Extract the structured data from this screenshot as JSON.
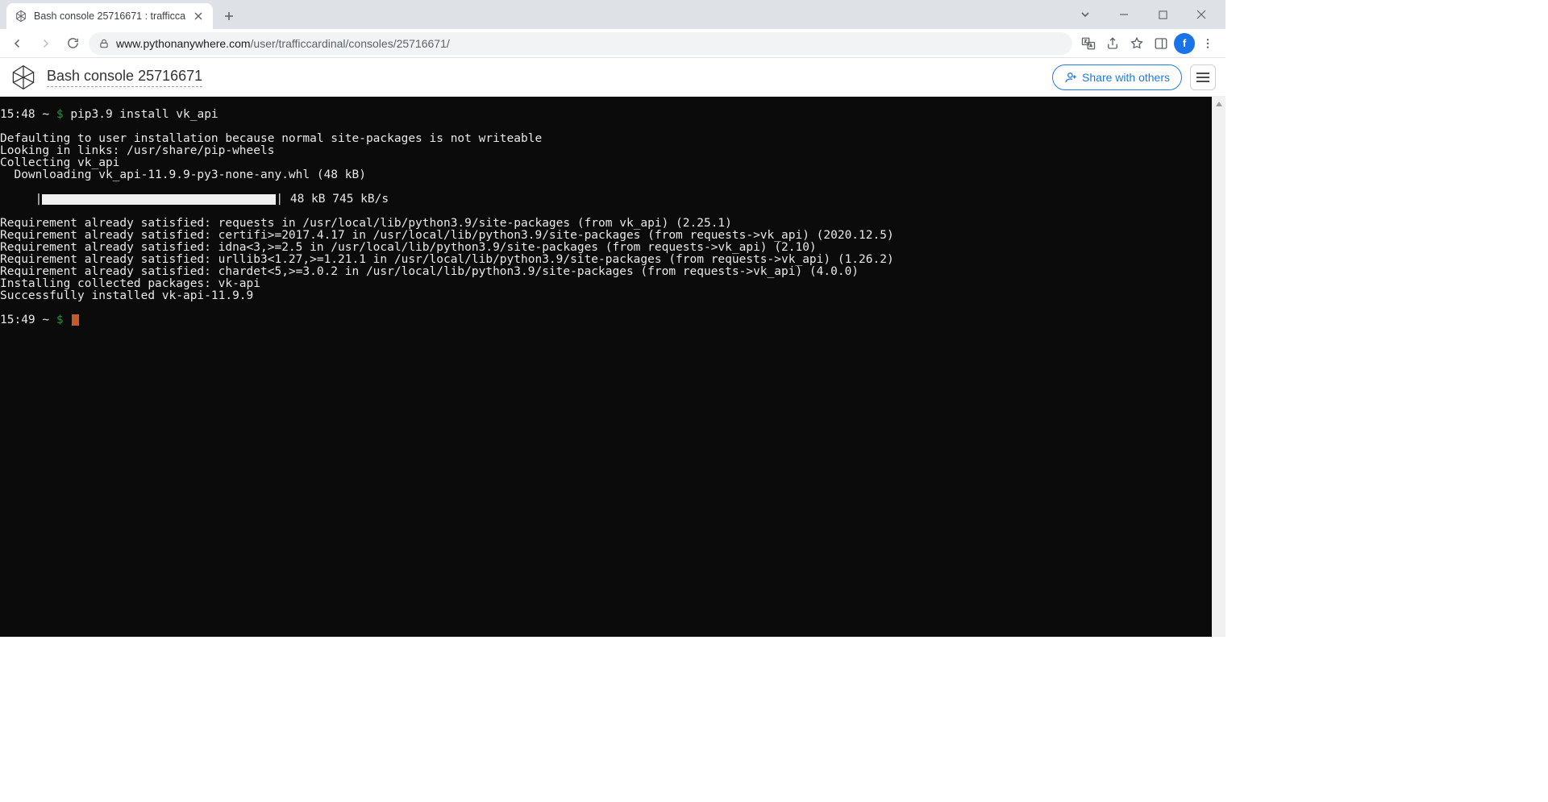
{
  "browser": {
    "tab_title": "Bash console 25716671 : trafficca",
    "url_host": "www.pythonanywhere.com",
    "url_path": "/user/trafficcardinal/consoles/25716671/",
    "avatar_letter": "f"
  },
  "page": {
    "title": "Bash console 25716671",
    "share_label": "Share with others"
  },
  "terminal": {
    "prompt1_time": "15:48",
    "prompt1_cwd": "~",
    "prompt1_symbol": "$",
    "prompt1_cmd": "pip3.9 install vk_api",
    "lines_before_progress": [
      "Defaulting to user installation because normal site-packages is not writeable",
      "Looking in links: /usr/share/pip-wheels",
      "Collecting vk_api",
      "  Downloading vk_api-11.9.9-py3-none-any.whl (48 kB)"
    ],
    "progress_prefix": "     |",
    "progress_suffix": "| 48 kB 745 kB/s",
    "lines_after_progress": [
      "Requirement already satisfied: requests in /usr/local/lib/python3.9/site-packages (from vk_api) (2.25.1)",
      "Requirement already satisfied: certifi>=2017.4.17 in /usr/local/lib/python3.9/site-packages (from requests->vk_api) (2020.12.5)",
      "Requirement already satisfied: idna<3,>=2.5 in /usr/local/lib/python3.9/site-packages (from requests->vk_api) (2.10)",
      "Requirement already satisfied: urllib3<1.27,>=1.21.1 in /usr/local/lib/python3.9/site-packages (from requests->vk_api) (1.26.2)",
      "Requirement already satisfied: chardet<5,>=3.0.2 in /usr/local/lib/python3.9/site-packages (from requests->vk_api) (4.0.0)",
      "Installing collected packages: vk-api",
      "Successfully installed vk-api-11.9.9"
    ],
    "prompt2_time": "15:49",
    "prompt2_cwd": "~",
    "prompt2_symbol": "$"
  }
}
